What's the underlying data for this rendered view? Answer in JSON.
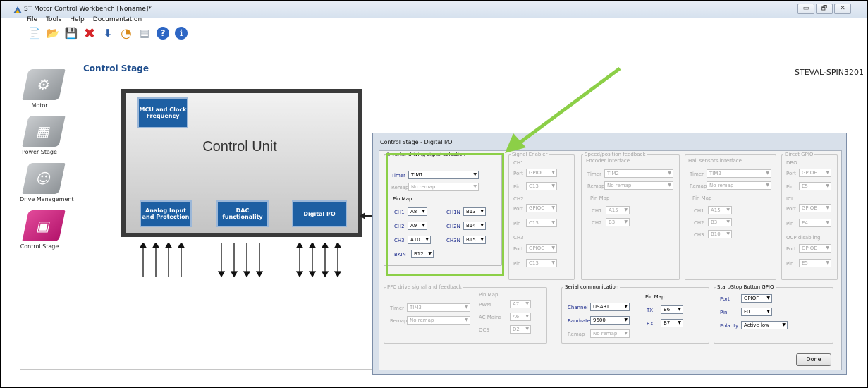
{
  "window": {
    "title": "ST Motor Control Workbench [Noname]*",
    "controls": [
      "▭",
      "🗗",
      "✕"
    ]
  },
  "menu": [
    "File",
    "Tools",
    "Help",
    "Documentation"
  ],
  "toolbar": [
    {
      "icon": "new-file-icon",
      "glyph": "📄"
    },
    {
      "icon": "open-folder-icon",
      "glyph": "📂"
    },
    {
      "icon": "save-icon",
      "glyph": "💾"
    },
    {
      "icon": "delete-icon",
      "glyph": "✖"
    },
    {
      "icon": "chip-download-icon",
      "glyph": "⬇"
    },
    {
      "icon": "clock-icon",
      "glyph": "◔"
    },
    {
      "icon": "monitor-icon",
      "glyph": "▤"
    },
    {
      "icon": "help-icon",
      "glyph": "?"
    },
    {
      "icon": "info-icon",
      "glyph": "i"
    }
  ],
  "section_title": "Control Stage",
  "board_name": "STEVAL-SPIN3201",
  "sidebar": [
    {
      "label": "Motor",
      "icon": "motor-icon"
    },
    {
      "label": "Power Stage",
      "icon": "power-stage-icon"
    },
    {
      "label": "Drive Management",
      "icon": "drive-management-icon"
    },
    {
      "label": "Control Stage",
      "icon": "control-stage-icon",
      "active": true
    }
  ],
  "control_unit": {
    "title": "Control Unit",
    "mcu": "MCU and Clock Frequency",
    "analog": "Analog Input and Protection",
    "dac": "DAC functionality",
    "digital": "Digital I/O"
  },
  "colors": {
    "accent": "#1d5fa3",
    "highlight": "#8ccf47",
    "active": "#d1257f"
  },
  "dialog": {
    "title": "Control Stage - Digital I/O",
    "inverter": {
      "title": "Inverter driving signal selection",
      "timer_label": "Timer",
      "timer": "TIM1",
      "remap_label": "Remap",
      "remap": "No remap",
      "pinmap_label": "Pin Map",
      "ch1": "CH1",
      "ch1_val": "A8",
      "ch1n": "CH1N",
      "ch1n_val": "B13",
      "ch2": "CH2",
      "ch2_val": "A9",
      "ch2n": "CH2N",
      "ch2n_val": "B14",
      "ch3": "CH3",
      "ch3_val": "A10",
      "ch3n": "CH3N",
      "ch3n_val": "B15",
      "bkin": "BKIN",
      "bkin_val": "B12"
    },
    "signal_enabler": {
      "title": "Signal Enabler",
      "ch1": "CH1",
      "port_label": "Port",
      "ch1_port": "GPIOC",
      "pin_label": "Pin",
      "ch1_pin": "C13",
      "ch2": "CH2",
      "ch2_port": "GPIOC",
      "ch2_pin": "C13",
      "ch3": "CH3",
      "ch3_port": "GPIOC",
      "ch3_pin": "C13"
    },
    "speed_feedback": {
      "title": "Speed/position feedback",
      "sub": "Encoder interface",
      "timer_label": "Timer",
      "timer": "TIM2",
      "remap_label": "Remap",
      "remap": "No remap",
      "pinmap_label": "Pin Map",
      "ch1": "CH1",
      "ch1_val": "A15",
      "ch2": "CH2",
      "ch2_val": "B3"
    },
    "hall": {
      "title": "Hall sensors interface",
      "timer_label": "Timer",
      "timer": "TIM2",
      "remap_label": "Remap",
      "remap": "No remap",
      "pinmap_label": "Pin Map",
      "ch1": "CH1",
      "ch1_val": "A15",
      "ch2": "CH2",
      "ch2_val": "B3",
      "ch3": "CH3",
      "ch3_val": "B10"
    },
    "direct_gpio": {
      "title": "Direct GPIO",
      "dbo": "DBO",
      "port_label": "Port",
      "dbo_port": "GPIOE",
      "pin_label": "Pin",
      "dbo_pin": "E5",
      "icl": "ICL",
      "icl_port": "GPIOE",
      "icl_pin": "E4",
      "ocp": "OCP disabling",
      "ocp_port": "GPIOE",
      "ocp_pin": "E5"
    },
    "pfc": {
      "title": "PFC drive signal and feedback",
      "timer_label": "Timer",
      "timer": "TIM3",
      "remap_label": "Remap",
      "remap": "No remap",
      "pinmap_label": "Pin Map",
      "pwm": "PWM",
      "pwm_val": "A7",
      "ac": "AC Mains",
      "ac_val": "A6",
      "ocs": "OCS",
      "ocs_val": "D2"
    },
    "serial": {
      "title": "Serial communication",
      "channel_label": "Channel",
      "channel": "USART1",
      "baud_label": "Baudrate",
      "baud": "9600",
      "remap_label": "Remap",
      "remap": "No remap",
      "pinmap_label": "Pin Map",
      "tx": "TX",
      "tx_val": "B6",
      "rx": "RX",
      "rx_val": "B7"
    },
    "startstop": {
      "title": "Start/Stop Button GPIO",
      "port_label": "Port",
      "port": "GPIOF",
      "pin_label": "Pin",
      "pin": "F0",
      "polarity_label": "Polarity",
      "polarity": "Active low"
    },
    "done": "Done"
  }
}
